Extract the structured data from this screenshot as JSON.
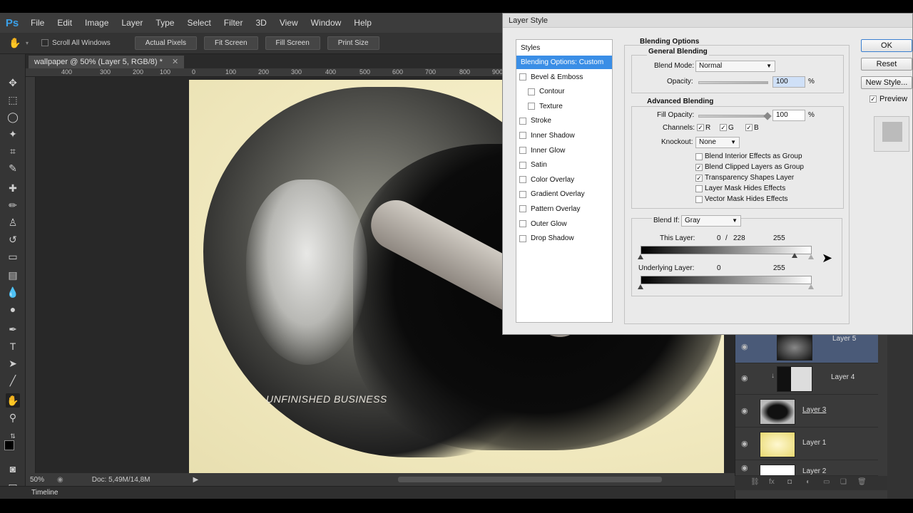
{
  "app": {
    "logo": "Ps",
    "menus": [
      "File",
      "Edit",
      "Image",
      "Layer",
      "Type",
      "Select",
      "Filter",
      "3D",
      "View",
      "Window",
      "Help"
    ]
  },
  "options": {
    "scroll_all": "Scroll All Windows",
    "buttons": [
      "Actual Pixels",
      "Fit Screen",
      "Fill Screen",
      "Print Size"
    ]
  },
  "document": {
    "tab": "wallpaper @ 50% (Layer 5, RGB/8) *",
    "ruler_top": [
      "400",
      "300",
      "200",
      "100",
      "0",
      "100",
      "200",
      "300",
      "400",
      "500",
      "600",
      "700",
      "800",
      "900"
    ],
    "artwork_text": "UNFINISHED BUSINESS"
  },
  "status": {
    "zoom": "50%",
    "doc": "Doc: 5,49M/14,8M",
    "timeline": "Timeline"
  },
  "layers": [
    {
      "name": "Layer 5"
    },
    {
      "name": "Layer 4"
    },
    {
      "name": "Layer 3"
    },
    {
      "name": "Layer 1"
    },
    {
      "name": "Layer 2"
    }
  ],
  "dialog": {
    "title": "Layer Style",
    "styles_header": "Styles",
    "styles": [
      {
        "label": "Blending Options: Custom",
        "active": true,
        "checkbox": false
      },
      {
        "label": "Bevel & Emboss",
        "checkbox": true
      },
      {
        "label": "Contour",
        "checkbox": true,
        "indent": true
      },
      {
        "label": "Texture",
        "checkbox": true,
        "indent": true
      },
      {
        "label": "Stroke",
        "checkbox": true
      },
      {
        "label": "Inner Shadow",
        "checkbox": true
      },
      {
        "label": "Inner Glow",
        "checkbox": true
      },
      {
        "label": "Satin",
        "checkbox": true
      },
      {
        "label": "Color Overlay",
        "checkbox": true
      },
      {
        "label": "Gradient Overlay",
        "checkbox": true
      },
      {
        "label": "Pattern Overlay",
        "checkbox": true
      },
      {
        "label": "Outer Glow",
        "checkbox": true
      },
      {
        "label": "Drop Shadow",
        "checkbox": true
      }
    ],
    "blending_options": "Blending Options",
    "general_blending": "General Blending",
    "blend_mode_label": "Blend Mode:",
    "blend_mode_value": "Normal",
    "opacity_label": "Opacity:",
    "opacity_value": "100",
    "percent": "%",
    "advanced_blending": "Advanced Blending",
    "fill_opacity_label": "Fill Opacity:",
    "fill_opacity_value": "100",
    "fill_opacity_fraction": 1.0,
    "channels_label": "Channels:",
    "channels": [
      "R",
      "G",
      "B"
    ],
    "knockout_label": "Knockout:",
    "knockout_value": "None",
    "adv_checks": [
      {
        "label": "Blend Interior Effects as Group",
        "checked": false
      },
      {
        "label": "Blend Clipped Layers as Group",
        "checked": true
      },
      {
        "label": "Transparency Shapes Layer",
        "checked": true
      },
      {
        "label": "Layer Mask Hides Effects",
        "checked": false
      },
      {
        "label": "Vector Mask Hides Effects",
        "checked": false
      }
    ],
    "blend_if_label": "Blend If:",
    "blend_if_value": "Gray",
    "this_layer_label": "This Layer:",
    "this_layer_low": "0",
    "this_layer_sep": "/",
    "this_layer_split": "228",
    "this_layer_high": "255",
    "underlying_label": "Underlying Layer:",
    "underlying_low": "0",
    "underlying_high": "255",
    "buttons": {
      "ok": "OK",
      "reset": "Reset",
      "new_style": "New Style...",
      "preview": "Preview"
    },
    "preview_checked": true
  }
}
